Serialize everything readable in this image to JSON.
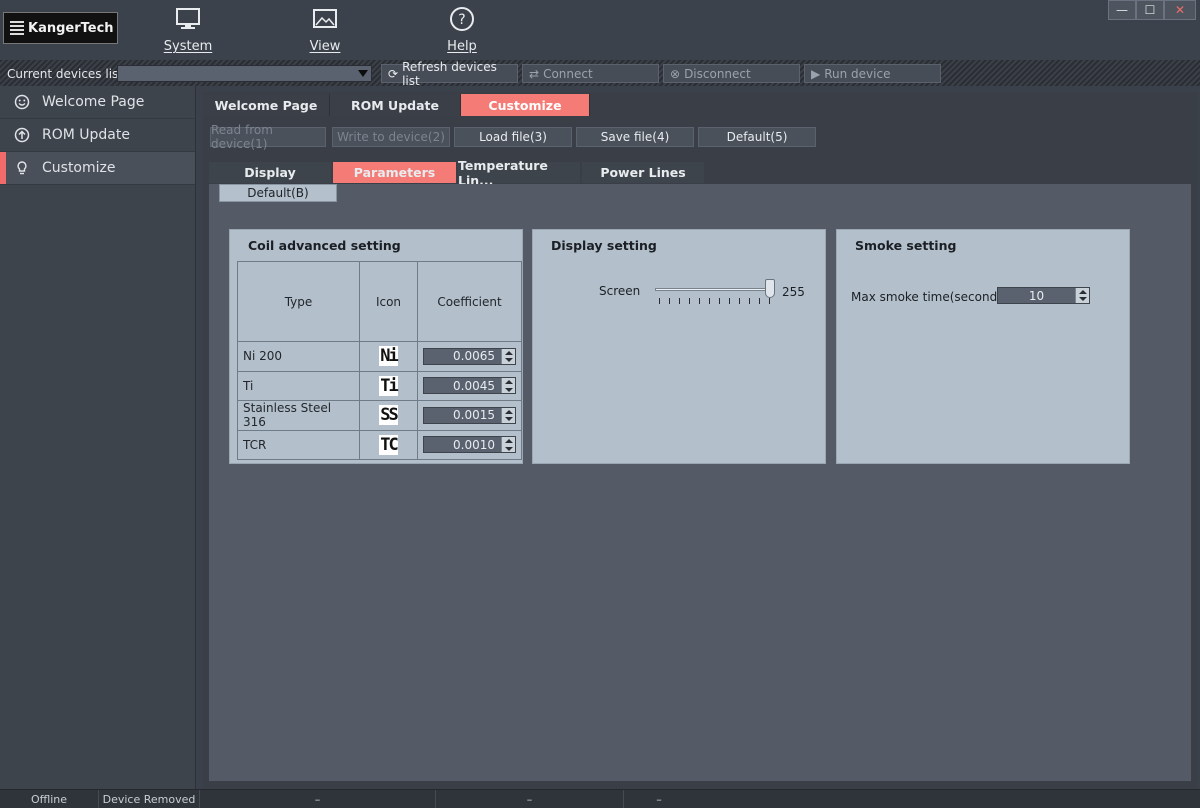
{
  "app": {
    "logo_text": "KangerTech"
  },
  "menu": {
    "system": "System",
    "view": "View",
    "help": "Help"
  },
  "window_controls": {
    "minimize": "—",
    "maximize": "☐",
    "close": "✕"
  },
  "device_bar": {
    "label": "Current devices list",
    "selected": "",
    "refresh": "Refresh devices list",
    "connect": "Connect",
    "disconnect": "Disconnect",
    "run": "Run device"
  },
  "sidebar": {
    "items": [
      {
        "label": "Welcome Page"
      },
      {
        "label": "ROM Update"
      },
      {
        "label": "Customize"
      }
    ]
  },
  "main_tabs": [
    "Welcome Page",
    "ROM Update",
    "Customize"
  ],
  "toolbar": {
    "read": "Read from device(1)",
    "write": "Write to device(2)",
    "load": "Load file(3)",
    "save": "Save file(4)",
    "default": "Default(5)"
  },
  "sub_tabs": [
    "Display",
    "Parameters",
    "Temperature Lin...",
    "Power Lines"
  ],
  "sub_default": "Default(B)",
  "coil": {
    "title": "Coil advanced setting",
    "headers": {
      "type": "Type",
      "icon": "Icon",
      "coef": "Coefficient"
    },
    "rows": [
      {
        "type": "Ni 200",
        "icon": "Ni",
        "coef": "0.0065"
      },
      {
        "type": "Ti",
        "icon": "Ti",
        "coef": "0.0045"
      },
      {
        "type": "Stainless Steel 316",
        "icon": "SS",
        "coef": "0.0015"
      },
      {
        "type": "TCR",
        "icon": "TC",
        "coef": "0.0010"
      }
    ]
  },
  "display_setting": {
    "title": "Display setting",
    "screen_label": "Screen",
    "screen_value": "255",
    "screen_level": 255,
    "screen_max": 255
  },
  "smoke_setting": {
    "title": "Smoke setting",
    "label": "Max smoke time(second)",
    "value": "10"
  },
  "status": {
    "conn": "Offline",
    "event": "Device Removed",
    "s3": "–",
    "s4": "–",
    "s5": "–"
  },
  "colors": {
    "accent": "#f47b76",
    "panel": "#b3c0cb"
  }
}
